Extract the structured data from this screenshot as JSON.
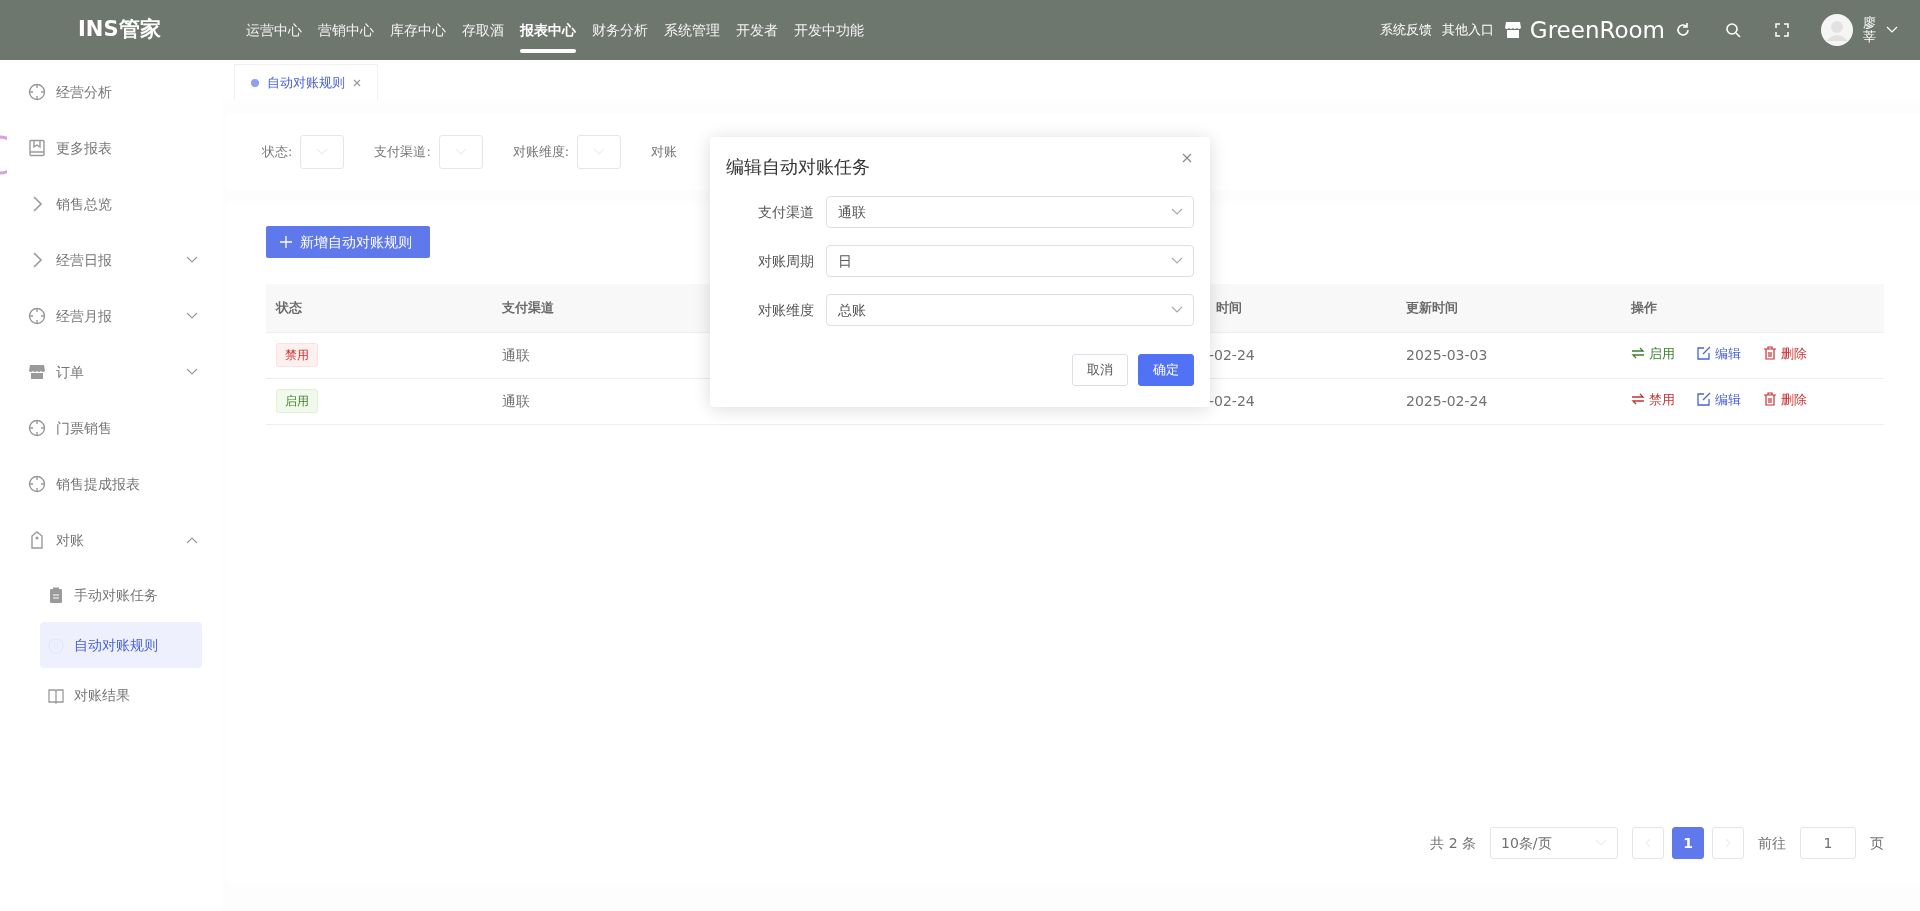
{
  "top_nav": {
    "logo": "INS管家",
    "menu": [
      {
        "label": "运营中心",
        "selected": false
      },
      {
        "label": "营销中心",
        "selected": false
      },
      {
        "label": "库存中心",
        "selected": false
      },
      {
        "label": "存取酒",
        "selected": false
      },
      {
        "label": "报表中心",
        "selected": true
      },
      {
        "label": "财务分析",
        "selected": false
      },
      {
        "label": "系统管理",
        "selected": false
      },
      {
        "label": "开发者",
        "selected": false
      },
      {
        "label": "开发中功能",
        "selected": false
      }
    ],
    "links": [
      "系统反馈",
      "其他入口"
    ],
    "store": "GreenRoom",
    "user": "廖莘"
  },
  "sidebar": {
    "items": [
      {
        "label": "经营分析"
      },
      {
        "label": "更多报表"
      },
      {
        "label": "销售总览"
      },
      {
        "label": "经营日报",
        "expanded": false
      },
      {
        "label": "经营月报",
        "expanded": false
      },
      {
        "label": "订单",
        "expanded": false
      },
      {
        "label": "门票销售"
      },
      {
        "label": "销售提成报表"
      },
      {
        "label": "对账",
        "expanded": true,
        "children": [
          {
            "label": "手动对账任务",
            "selected": false
          },
          {
            "label": "自动对账规则",
            "selected": true
          },
          {
            "label": "对账结果",
            "selected": false
          }
        ]
      }
    ]
  },
  "tabs": [
    {
      "label": "自动对账规则",
      "selected": true
    }
  ],
  "filters": [
    {
      "label": "状态:"
    },
    {
      "label": "支付渠道:"
    },
    {
      "label": "对账维度:"
    },
    {
      "label": "对账"
    }
  ],
  "add_button": "新增自动对账规则",
  "table": {
    "columns": [
      "状态",
      "支付渠道",
      "时间",
      "更新时间",
      "操作"
    ],
    "rows": [
      {
        "status": "禁用",
        "enabled": false,
        "channel": "通联",
        "created": "-02-24",
        "updated": "2025-03-03",
        "actions": [
          {
            "label": "启用",
            "kind": "toggle"
          },
          {
            "label": "编辑",
            "kind": "edit"
          },
          {
            "label": "删除",
            "kind": "delete"
          }
        ]
      },
      {
        "status": "启用",
        "enabled": true,
        "channel": "通联",
        "created": "-02-24",
        "updated": "2025-02-24",
        "actions": [
          {
            "label": "禁用",
            "kind": "toggle"
          },
          {
            "label": "编辑",
            "kind": "edit"
          },
          {
            "label": "删除",
            "kind": "delete"
          }
        ]
      }
    ]
  },
  "pagination": {
    "total": "共 2 条",
    "page_size": "10条/页",
    "pages": [
      {
        "label": "1",
        "selected": true
      }
    ],
    "goto_label": "前往",
    "goto_value": "1",
    "goto_suffix": "页"
  },
  "dialog": {
    "title": "编辑自动对账任务",
    "fields": [
      {
        "label": "支付渠道",
        "value": "通联"
      },
      {
        "label": "对账周期",
        "value": "日"
      },
      {
        "label": "对账维度",
        "value": "总账"
      }
    ],
    "buttons": [
      {
        "label": "取消",
        "kind": "secondary"
      },
      {
        "label": "确定",
        "kind": "primary"
      }
    ]
  }
}
